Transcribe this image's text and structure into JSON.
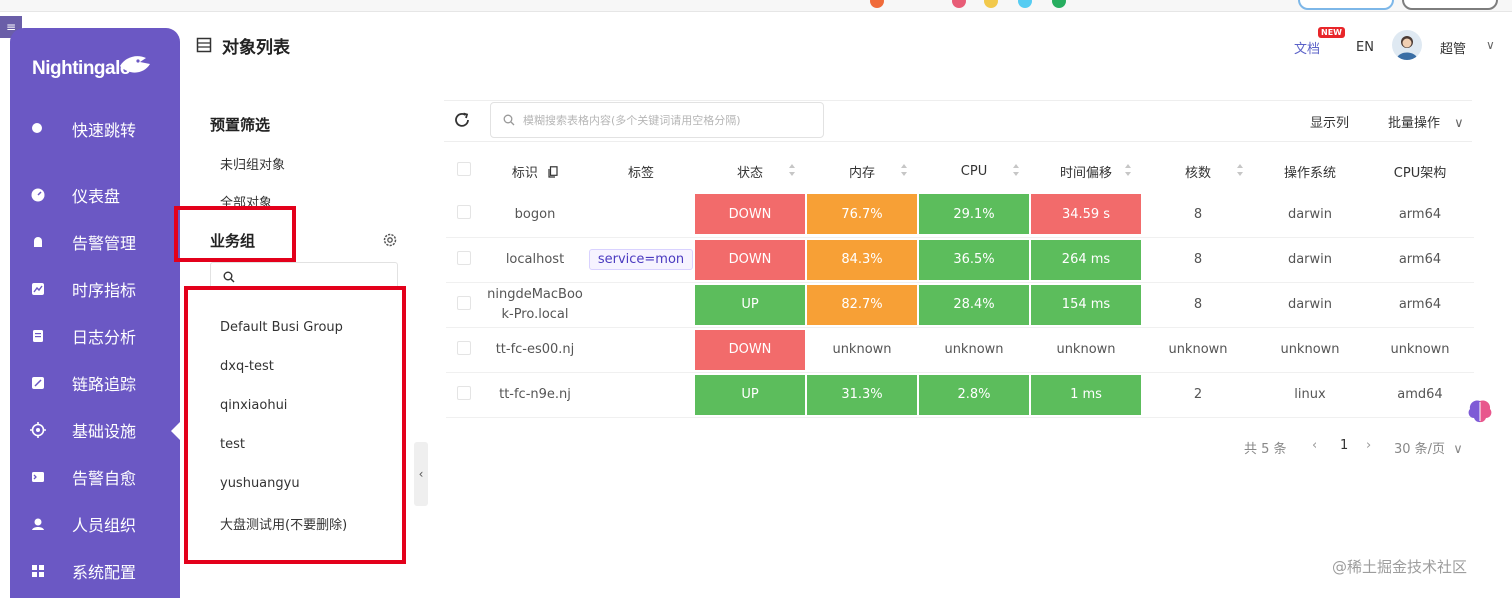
{
  "app": {
    "logo_text": "Nightingale",
    "page_title": "对象列表"
  },
  "sidebar": {
    "items": [
      {
        "label": "快速跳转",
        "icon": "search-icon"
      },
      {
        "label": "仪表盘",
        "icon": "dashboard-icon"
      },
      {
        "label": "告警管理",
        "icon": "alarm-icon"
      },
      {
        "label": "时序指标",
        "icon": "chart-icon"
      },
      {
        "label": "日志分析",
        "icon": "log-icon"
      },
      {
        "label": "链路追踪",
        "icon": "trace-icon"
      },
      {
        "label": "基础设施",
        "icon": "target-icon",
        "active": true
      },
      {
        "label": "告警自愈",
        "icon": "terminal-icon"
      },
      {
        "label": "人员组织",
        "icon": "user-icon"
      },
      {
        "label": "系统配置",
        "icon": "grid-icon"
      }
    ]
  },
  "header": {
    "doc_label": "文档",
    "new_badge": "NEW",
    "lang": "EN",
    "user": "超管"
  },
  "filters": {
    "preset_title": "预置筛选",
    "preset_items": [
      "未归组对象",
      "全部对象"
    ],
    "group_title": "业务组",
    "groups": [
      "Default Busi Group",
      "dxq-test",
      "qinxiaohui",
      "test",
      "yushuangyu",
      "大盘测试用(不要删除)"
    ]
  },
  "toolbar": {
    "search_placeholder": "模糊搜索表格内容(多个关键词请用空格分隔)",
    "columns_label": "显示列",
    "batch_label": "批量操作"
  },
  "table": {
    "headers": [
      "标识",
      "标签",
      "状态",
      "内存",
      "CPU",
      "时间偏移",
      "核数",
      "操作系统",
      "CPU架构"
    ],
    "rows": [
      {
        "ident": "bogon",
        "tag": "",
        "status": "DOWN",
        "mem": "76.7%",
        "cpu": "29.1%",
        "offset": "34.59 s",
        "cores": "8",
        "os": "darwin",
        "arch": "arm64"
      },
      {
        "ident": "localhost",
        "tag": "service=mon",
        "status": "DOWN",
        "mem": "84.3%",
        "cpu": "36.5%",
        "offset": "264 ms",
        "cores": "8",
        "os": "darwin",
        "arch": "arm64"
      },
      {
        "ident": "ningdeMacBook-Pro.local",
        "tag": "",
        "status": "UP",
        "mem": "82.7%",
        "cpu": "28.4%",
        "offset": "154 ms",
        "cores": "8",
        "os": "darwin",
        "arch": "arm64"
      },
      {
        "ident": "tt-fc-es00.nj",
        "tag": "",
        "status": "DOWN",
        "mem": "unknown",
        "cpu": "unknown",
        "offset": "unknown",
        "cores": "unknown",
        "os": "unknown",
        "arch": "unknown"
      },
      {
        "ident": "tt-fc-n9e.nj",
        "tag": "",
        "status": "UP",
        "mem": "31.3%",
        "cpu": "2.8%",
        "offset": "1 ms",
        "cores": "2",
        "os": "linux",
        "arch": "amd64"
      }
    ]
  },
  "pagination": {
    "total": "共 5 条",
    "page": "1",
    "page_size": "30 条/页"
  },
  "watermark": "@稀土掘金技术社区",
  "colors": {
    "sidebar": "#6b58c4",
    "down": "#f26b6b",
    "up": "#5cbd5c",
    "warn": "#f7a036",
    "highlight": "#e3001b",
    "accent": "#5b62c8"
  }
}
